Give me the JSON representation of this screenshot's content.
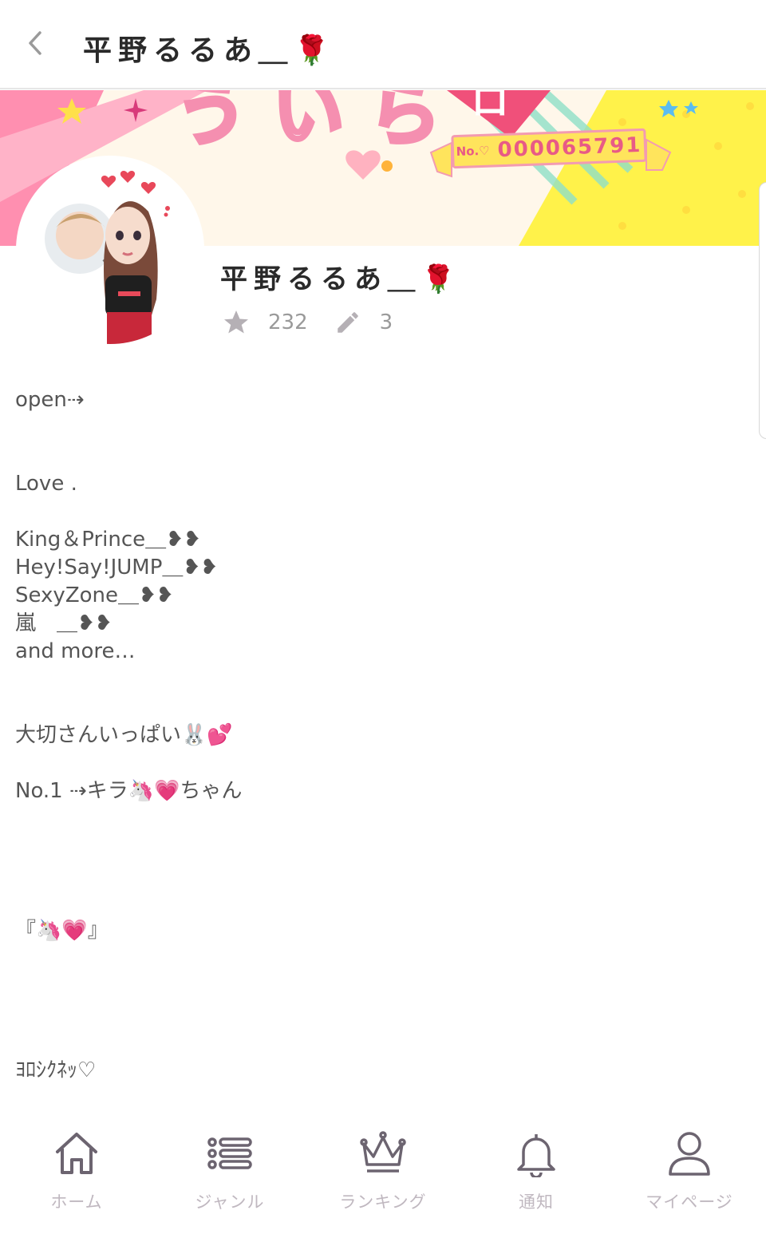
{
  "header": {
    "title": "平野るるあ＿🌹"
  },
  "banner": {
    "badge_label": "No.♡",
    "badge_number": "000065791",
    "colors": {
      "pink": "#ff7fa3",
      "yellow": "#fff24a",
      "cream": "#fff7ea"
    }
  },
  "profile": {
    "name": "平野るるあ＿🌹",
    "stars_icon": "star-icon",
    "stars_count": "232",
    "posts_icon": "pencil-icon",
    "posts_count": "3"
  },
  "bio": {
    "line_open": "open⇢",
    "line_love": "Love .",
    "fan_items": [
      "King＆Prince＿❥❥",
      "Hey!Say!JUMP＿❥❥",
      "SexyZone＿❥❥",
      "嵐　＿❥❥",
      "and more…"
    ],
    "line_taisetsu": "大切さんいっぱい🐰💕",
    "line_no1": "No.1 ⇢キラ🦄💗ちゃん",
    "line_bracket": "『🦄💗』",
    "line_yoroshiku": "ﾖﾛｼｸﾈｯ♡"
  },
  "bottom_nav": {
    "items": [
      {
        "label": "ホーム",
        "icon": "home-icon"
      },
      {
        "label": "ジャンル",
        "icon": "list-icon"
      },
      {
        "label": "ランキング",
        "icon": "crown-icon"
      },
      {
        "label": "通知",
        "icon": "bell-icon"
      },
      {
        "label": "マイページ",
        "icon": "person-icon"
      }
    ]
  }
}
